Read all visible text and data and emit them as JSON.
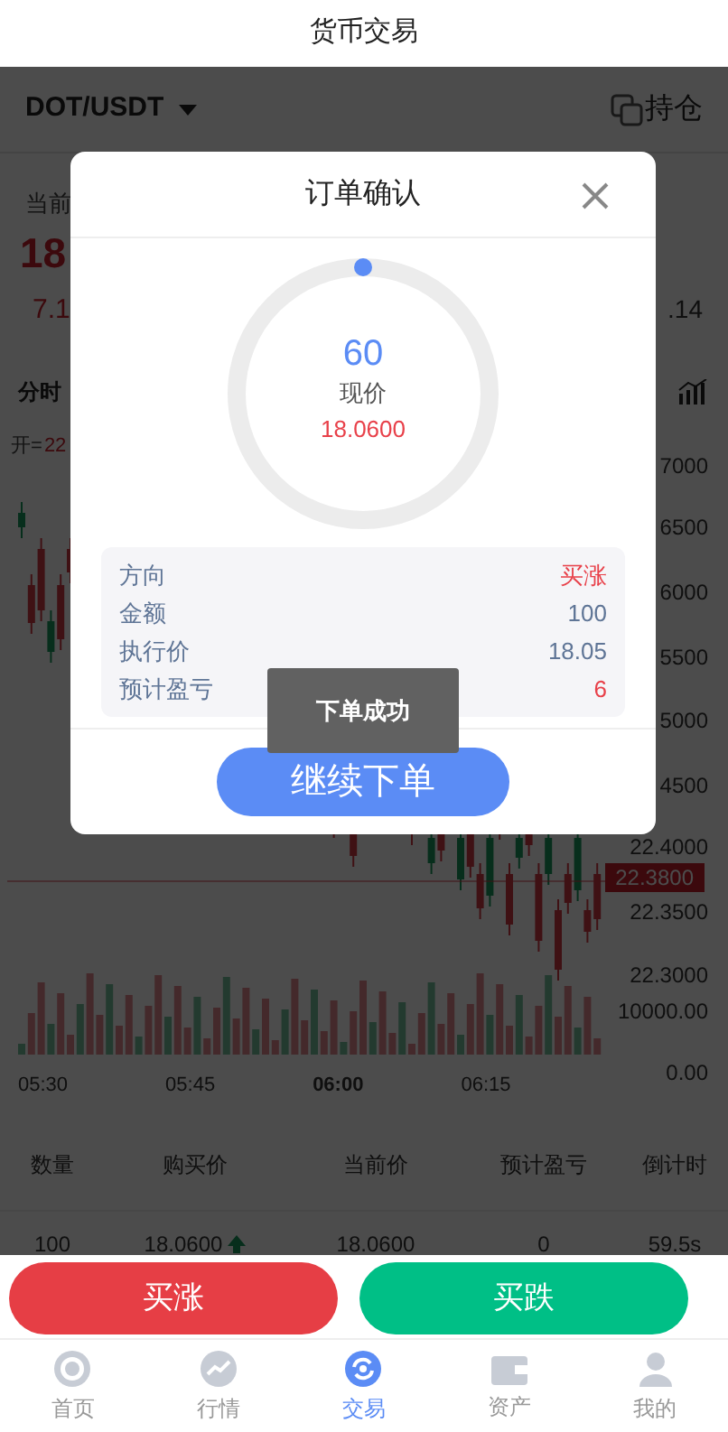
{
  "header": {
    "title": "货币交易"
  },
  "pair": {
    "symbol": "DOT/USDT",
    "positions_label": "持仓"
  },
  "price": {
    "label": "当前",
    "value": "18",
    "change": "7.1",
    "right_value": ".14"
  },
  "chart": {
    "tab": "分时",
    "open_label": "开=",
    "open_value": "22",
    "axis_labels": [
      "7000",
      "6500",
      "6000",
      "5500",
      "5000",
      "4500",
      "22.4000",
      "22.3500",
      "22.3000",
      "10000.00",
      "0.00"
    ],
    "current_tag": "22.3800",
    "times": [
      {
        "label": "05:30",
        "bold": false
      },
      {
        "label": "05:45",
        "bold": false
      },
      {
        "label": "06:00",
        "bold": true
      },
      {
        "label": "06:15",
        "bold": false
      }
    ]
  },
  "table": {
    "columns": [
      "数量",
      "购买价",
      "当前价",
      "预计盈亏",
      "倒计时"
    ],
    "rows": [
      [
        "100",
        "18.0600",
        "18.0600",
        "0",
        "59.5s"
      ]
    ]
  },
  "modal": {
    "title": "订单确认",
    "countdown": "60",
    "price_label": "现价",
    "price": "18.0600",
    "details": [
      {
        "label": "方向",
        "value": "买涨",
        "color": "#e8414a"
      },
      {
        "label": "金额",
        "value": "100",
        "color": "#5f7596"
      },
      {
        "label": "执行价",
        "value": "18.05",
        "color": "#5f7596"
      },
      {
        "label": "预计盈亏",
        "value": "6",
        "color": "#e8414a"
      }
    ],
    "button": "继续下单"
  },
  "toast": "下单成功",
  "actions": [
    {
      "label": "买涨",
      "kind": "up"
    },
    {
      "label": "买跌",
      "kind": "down"
    }
  ],
  "tabbar": [
    {
      "label": "首页",
      "selected": false
    },
    {
      "label": "行情",
      "selected": false
    },
    {
      "label": "交易",
      "selected": true
    },
    {
      "label": "资产",
      "selected": false
    },
    {
      "label": "我的",
      "selected": false
    }
  ]
}
